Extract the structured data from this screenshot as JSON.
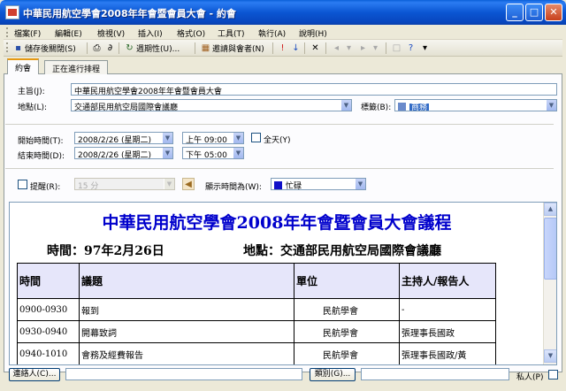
{
  "window": {
    "title": "中華民用航空學會2008年年會暨會員大會 - 約會",
    "min": "_",
    "max": "□",
    "close": "✕"
  },
  "menu": [
    "檔案(F)",
    "編輯(E)",
    "檢視(V)",
    "插入(I)",
    "格式(O)",
    "工具(T)",
    "執行(A)",
    "說明(H)"
  ],
  "toolbar": {
    "save_close": "儲存後關閉(S)",
    "recurrence": "週期性(U)...",
    "invite": "邀請與會者(N)"
  },
  "tabs": [
    "約會",
    "正在進行排程"
  ],
  "form": {
    "subject_label": "主旨(J):",
    "subject_value": "中華民用航空學會2008年年會暨會員大會",
    "location_label": "地點(L):",
    "location_value": "交通部民用航空局國際會議廳",
    "label_label": "標籤(B):",
    "label_value": "商務",
    "label_color": "#6a8acb",
    "start_label": "開始時間(T):",
    "start_date": "2008/2/26 (星期二)",
    "start_time": "上午 09:00",
    "allday_label": "全天(Y)",
    "end_label": "結束時間(D):",
    "end_date": "2008/2/26 (星期二)",
    "end_time": "下午 05:00",
    "reminder_label": "提醒(R):",
    "reminder_value": "15 分",
    "showas_label": "顯示時間為(W):",
    "showas_value": "忙碌",
    "showas_color": "#1010c8"
  },
  "doc": {
    "title": "中華民用航空學會2008年年會暨會員大會議程",
    "date_line": "時間：97年2月26日",
    "place_line": "地點：交通部民用航空局國際會議廳",
    "headers": [
      "時間",
      "議題",
      "單位",
      "主持人/報告人"
    ],
    "rows": [
      [
        "0900-0930",
        "報到",
        "民航學會",
        "-"
      ],
      [
        "0930-0940",
        "開幕致詞",
        "民航學會",
        "張理事長國政"
      ],
      [
        "0940-1010",
        "會務及經費報告",
        "民航學會",
        "張理事長國政/黃"
      ]
    ]
  },
  "bottom": {
    "contacts": "連絡人(C)...",
    "categories": "類別(G)...",
    "private": "私人(P)"
  }
}
